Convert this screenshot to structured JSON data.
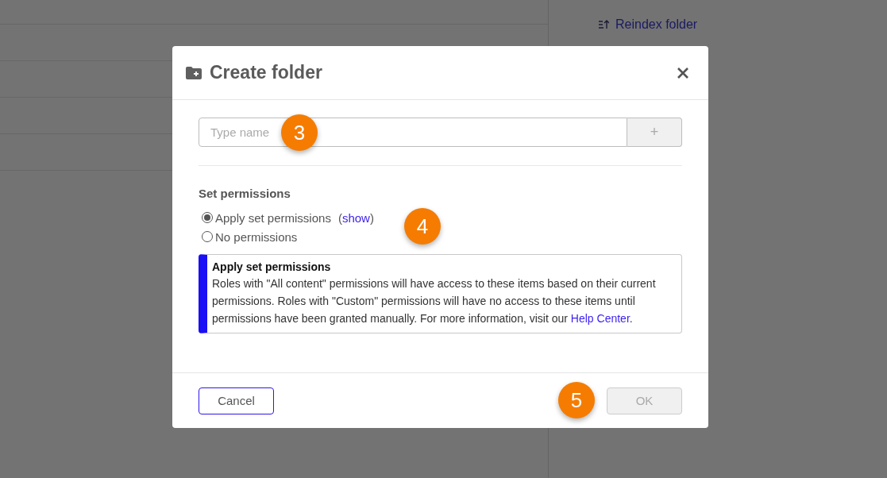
{
  "background": {
    "sidebar_links": [
      {
        "label": "Reindex folder"
      }
    ]
  },
  "dialog": {
    "title": "Create folder",
    "name_field": {
      "placeholder": "Type name",
      "add_button": {
        "label": "+",
        "disabled": true
      }
    },
    "permissions": {
      "heading": "Set permissions",
      "options": [
        {
          "label": "Apply set permissions",
          "selected": true,
          "link_prefix": "(",
          "link": "show",
          "link_suffix": ")"
        },
        {
          "label": "No permissions",
          "selected": false
        }
      ],
      "info": {
        "title": "Apply set permissions",
        "text": "Roles with \"All content\" permissions will have access to these items based on their current permissions. Roles with \"Custom\" permissions will have no access to these items until permissions have been granted manually. For more information, visit our",
        "link": "Help Center",
        "after_link": "."
      }
    },
    "buttons": [
      {
        "label": "Cancel",
        "kind": "secondary",
        "disabled": false
      },
      {
        "label": "OK",
        "kind": "primary",
        "disabled": true
      }
    ]
  },
  "markers": [
    {
      "label": "3"
    },
    {
      "label": "4"
    },
    {
      "label": "5"
    }
  ]
}
